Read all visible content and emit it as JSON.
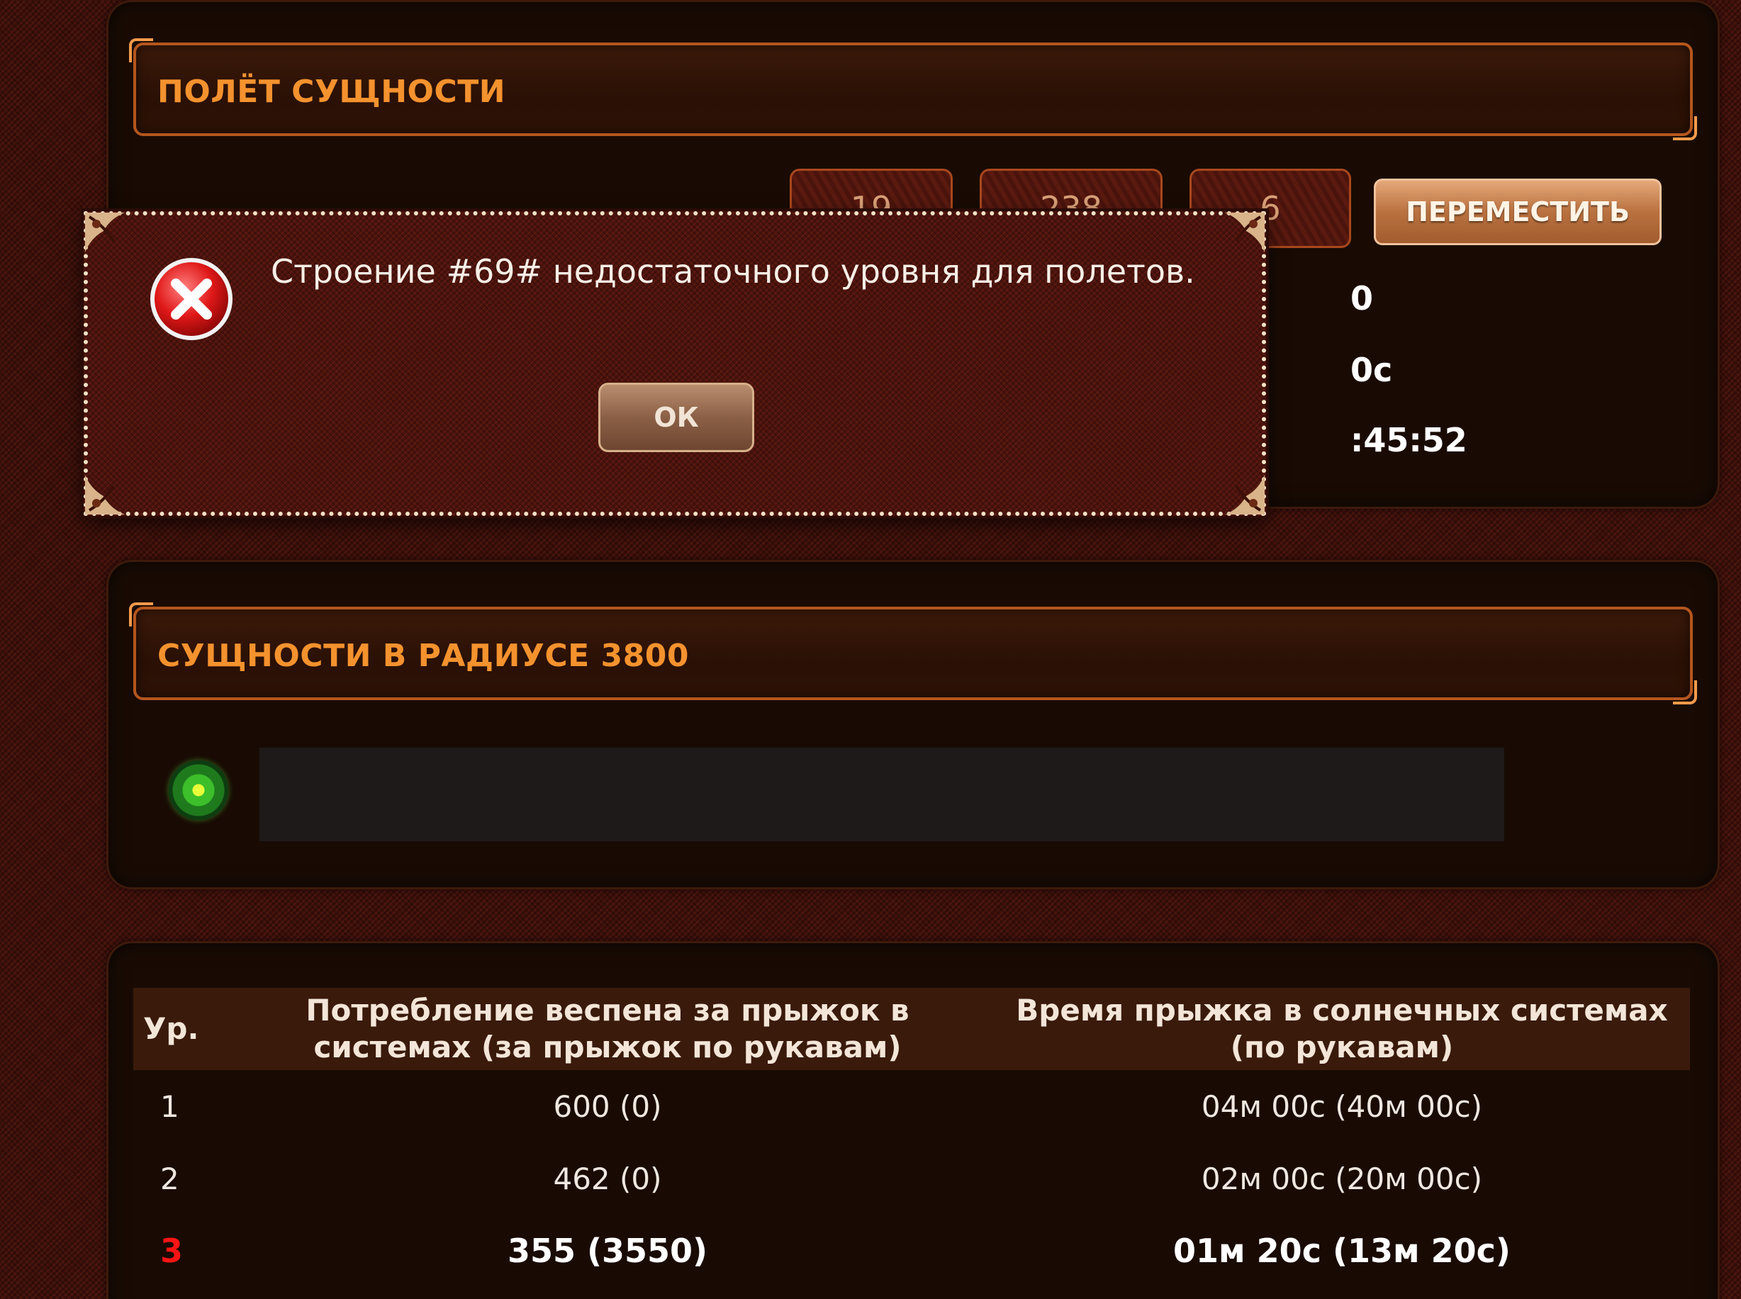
{
  "flight_panel": {
    "title": "ПОЛЁТ СУЩНОСТИ",
    "coordinates": [
      "19",
      "238",
      "6"
    ],
    "move_button": "ПЕРЕМЕСТИТЬ",
    "partial_values": [
      "0",
      "0с",
      ":45:52"
    ]
  },
  "nearby_panel": {
    "title": "СУЩНОСТИ В РАДИУСЕ 3800"
  },
  "levels_table": {
    "headers": [
      "Ур.",
      "Потребление веспена за прыжок в системах (за прыжок по рукавам)",
      "Время прыжка в солнечных системах (по рукавам)"
    ],
    "rows": [
      {
        "level": "1",
        "consumption": "600 (0)",
        "time": "04м 00с (40м 00с)"
      },
      {
        "level": "2",
        "consumption": "462 (0)",
        "time": "02м 00с (20м 00с)"
      },
      {
        "level": "3",
        "consumption": "355 (3550)",
        "time": "01м 20с (13м 20с)"
      }
    ],
    "current_level": "3"
  },
  "dialog": {
    "message": "Строение #69# недостаточного уровня для полетов.",
    "ok_label": "ОК",
    "icon": "error-icon"
  },
  "colors": {
    "title_orange": "#f4922e",
    "current_level_red": "#ff1414"
  }
}
